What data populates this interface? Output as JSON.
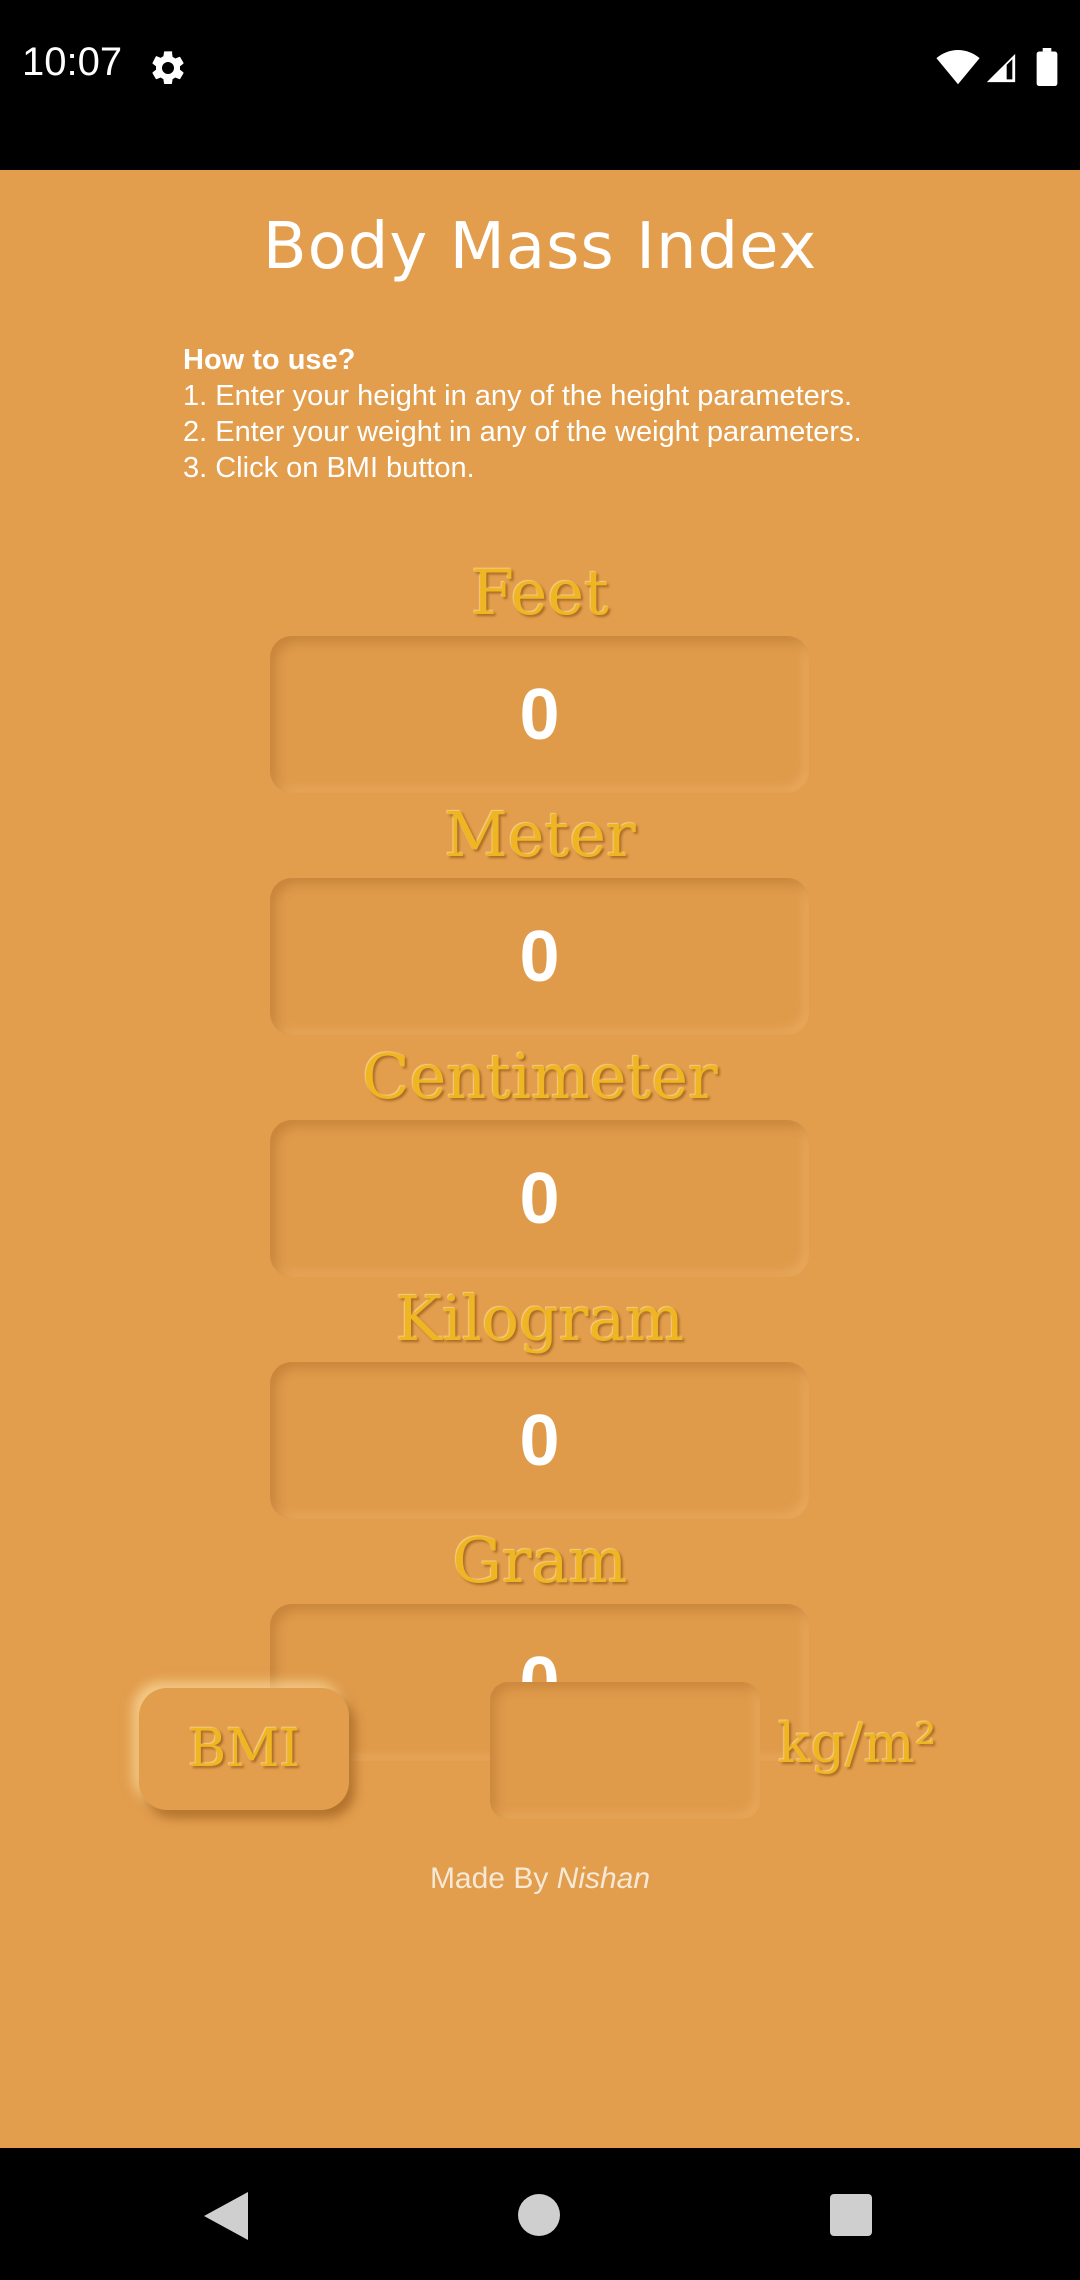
{
  "status_bar": {
    "time": "10:07",
    "icons": [
      "gear-icon",
      "wifi-icon",
      "signal-icon",
      "battery-icon"
    ]
  },
  "title": "Body Mass Index",
  "instructions": {
    "heading": "How to use?",
    "steps": [
      "1. Enter your height in any of the height parameters.",
      "2. Enter your weight in any of the weight parameters.",
      "3. Click on BMI button."
    ]
  },
  "fields": [
    {
      "label": "Feet",
      "value": "0"
    },
    {
      "label": "Meter",
      "value": "0"
    },
    {
      "label": "Centimeter",
      "value": "0"
    },
    {
      "label": "Kilogram",
      "value": "0"
    },
    {
      "label": "Gram",
      "value": "0"
    }
  ],
  "bmi_button": {
    "label": "BMI"
  },
  "result": {
    "value": "",
    "unit": "kg/m²"
  },
  "footer": {
    "prefix": "Made By",
    "author": "Nishan"
  },
  "nav_bar": {
    "icons": [
      "back-icon",
      "home-icon",
      "recents-icon"
    ]
  },
  "colors": {
    "background": "#e29d4d",
    "label_gold": "#f0b522",
    "text_white": "#ffffff",
    "bars": "#000000"
  }
}
